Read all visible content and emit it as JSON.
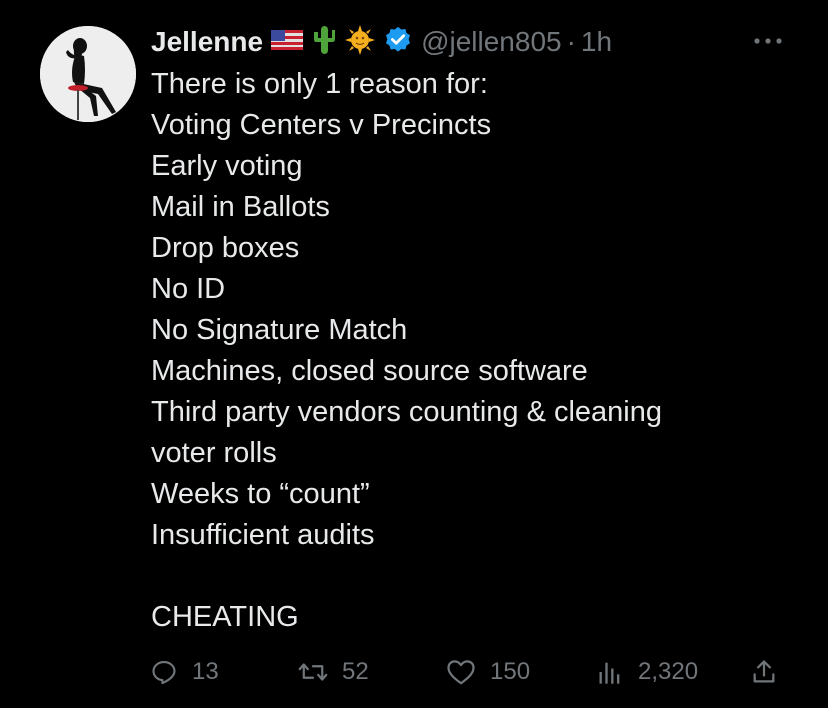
{
  "author": {
    "name": "Jellenne",
    "badges": [
      "us-flag-icon",
      "cactus-icon",
      "sun-icon"
    ],
    "verified": true,
    "handle": "@jellen805",
    "separator": "·",
    "time": "1h"
  },
  "body": {
    "lines": [
      "There is only 1 reason for:",
      "Voting Centers v Precincts",
      "Early voting",
      "Mail in Ballots",
      "Drop boxes",
      "No ID",
      "No Signature Match",
      "Machines, closed source software",
      "Third party vendors counting & cleaning",
      "voter rolls",
      "Weeks to “count”",
      "Insufficient audits",
      "",
      "CHEATING"
    ]
  },
  "actions": {
    "replies": "13",
    "retweets": "52",
    "likes": "150",
    "views": "2,320"
  },
  "colors": {
    "background": "#000000",
    "text": "#e7e9ea",
    "muted": "#71767b",
    "verified": "#1d9bf0"
  }
}
